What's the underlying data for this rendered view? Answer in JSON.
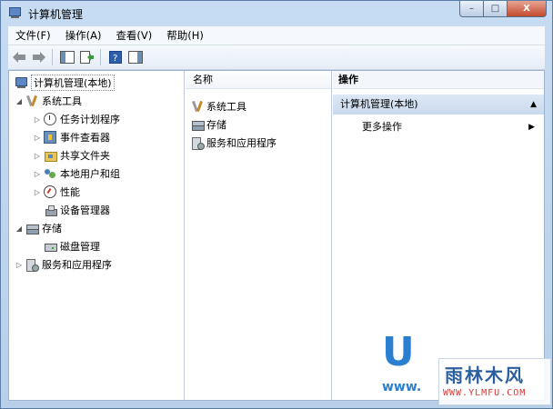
{
  "window": {
    "title": "计算机管理",
    "controls": {
      "minimize": "–",
      "maximize": "□",
      "close": "X"
    }
  },
  "menu": [
    "文件(F)",
    "操作(A)",
    "查看(V)",
    "帮助(H)"
  ],
  "toolbar": {
    "icons": [
      "back-arrow-icon",
      "forward-arrow-icon",
      "show-hide-tree-icon",
      "export-list-icon",
      "help-icon",
      "show-hide-action-pane-icon"
    ]
  },
  "tree": {
    "root": "计算机管理(本地)",
    "system_tools": "系统工具",
    "task_scheduler": "任务计划程序",
    "event_viewer": "事件查看器",
    "shared_folders": "共享文件夹",
    "local_users": "本地用户和组",
    "performance": "性能",
    "device_manager": "设备管理器",
    "storage": "存储",
    "disk_management": "磁盘管理",
    "services_apps": "服务和应用程序"
  },
  "list": {
    "header": "名称",
    "items": [
      "系统工具",
      "存储",
      "服务和应用程序"
    ]
  },
  "actions": {
    "header": "操作",
    "section": "计算机管理(本地)",
    "more": "更多操作"
  },
  "watermark": {
    "big": "U",
    "brand": "雨林木风",
    "url": "WWW.YLMFU.COM",
    "www": "www."
  }
}
